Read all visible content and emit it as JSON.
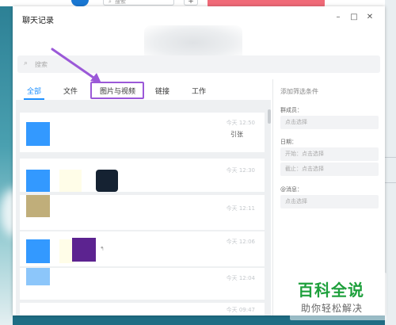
{
  "background": {
    "top_search_placeholder": "搜索",
    "top_plus": "+"
  },
  "window": {
    "title": "聊天记录",
    "minimize_glyph": "–",
    "maximize_glyph": "□",
    "close_glyph": "✕"
  },
  "search": {
    "icon": "search-icon",
    "placeholder": "搜索"
  },
  "tabs": [
    {
      "label": "全部",
      "active": true
    },
    {
      "label": "文件",
      "active": false
    },
    {
      "label": "图片与视频",
      "active": false,
      "highlighted": true
    },
    {
      "label": "链接",
      "active": false
    },
    {
      "label": "工作",
      "active": false
    }
  ],
  "messages": [
    {
      "time": "今天 12:50",
      "snippet": "引张"
    },
    {
      "time": "今天 12:30",
      "snippet": ""
    },
    {
      "time": "今天 12:11",
      "snippet": ""
    },
    {
      "time": "今天 12:06",
      "snippet": "ᖳ"
    },
    {
      "time": "今天 12:04",
      "snippet": ""
    },
    {
      "time": "今天 09:47",
      "snippet": ""
    }
  ],
  "filter": {
    "title": "添加筛选条件",
    "member_label": "群成员：",
    "member_placeholder": "点击选择",
    "date_label": "日期：",
    "start_text": "开始：点击选择",
    "end_text": "截止：点击选择",
    "message_label": "@消息：",
    "message_placeholder": "点击选择"
  },
  "watermark": {
    "main": "百科全说",
    "sub": "助你轻松解决"
  },
  "colors": {
    "accent": "#1e90ff",
    "highlight": "#9b59d8",
    "tile_blue": "#3399ff",
    "tile_cream": "#fffde8",
    "tile_navy": "#152232",
    "tile_tan": "#c0ae7a",
    "tile_purple": "#5c2390",
    "tile_lightblue": "#8cc6fa",
    "watermark_green": "#1ea03c"
  }
}
